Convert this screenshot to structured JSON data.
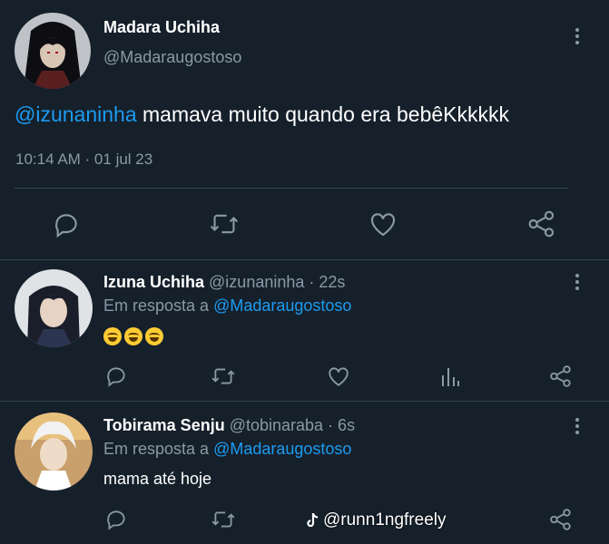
{
  "main_tweet": {
    "author_name": "Madara Uchiha",
    "author_handle": "@Madaraugostoso",
    "mention": "@izunaninha",
    "text": " mamava muito quando era bebêKkkkkk",
    "timestamp": "10:14 AM · 01 jul 23",
    "actions": [
      "reply-icon",
      "retweet-icon",
      "like-icon",
      "share-icon"
    ]
  },
  "replies": [
    {
      "author_name": "Izuna Uchiha",
      "author_handle": "@izunaninha · 22s",
      "reply_prefix": "Em resposta a",
      "reply_to": "@Madaraugostoso",
      "text": "😅😅😅"
    },
    {
      "author_name": "Tobirama Senju",
      "author_handle": "@tobinaraba · 6s",
      "reply_prefix": "Em resposta a",
      "reply_to": "@Madaraugostoso",
      "text": "mama até hoje"
    }
  ],
  "watermark": {
    "text": "@runn1ngfreely"
  },
  "colors": {
    "background": "#15202b",
    "accent": "#1d9bf0",
    "muted": "#8b98a5",
    "divider": "#38444d"
  }
}
